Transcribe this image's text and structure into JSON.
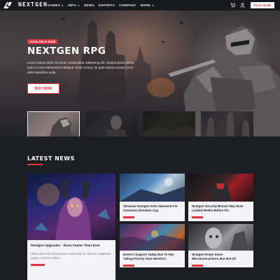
{
  "nav": {
    "brand": "NEXTGEN",
    "menu": [
      {
        "label": "GAMES",
        "has_caret": true
      },
      {
        "label": "INFO",
        "has_caret": true
      },
      {
        "label": "NEWS",
        "has_caret": false
      },
      {
        "label": "ESPORTS",
        "has_caret": false
      },
      {
        "label": "COMPANY",
        "has_caret": false
      },
      {
        "label": "MORE",
        "has_caret": true
      }
    ],
    "cart_icon": "cart-icon",
    "account_icon": "user-icon",
    "play_label": "PLAY NOW"
  },
  "hero": {
    "badge": "AVAILABLE NOW",
    "title": "NEXTGEN RPG",
    "description": "Lorem ipsum dolor sit amet, consectetur adipiscing elit. Suspendisse varius enim in eros elementum tristique. Duis cursus, mi quis viverra ornare, eros dolor interdum nulla.",
    "button": "BUY NOW",
    "thumbnails_count": 4,
    "active_thumbnail": 1
  },
  "news": {
    "title": "LATEST NEWS",
    "featured": {
      "title": "Nextgen Upgrades - Runs Faster Than Ever",
      "excerpt": "Officia eius nihil doloremque consectetur in. Sunt ut voluptatem eaque inventore dolore."
    },
    "items": [
      {
        "title": "Streamer Nextgen Gets Slammed For Generous Donation Cap"
      },
      {
        "title": "Nextgen Security Breach May Have Leaked Weeks Before Fix"
      },
      {
        "title": "Doesn't Support 1440p Due To Fps Taking Priority Over Monitors"
      },
      {
        "title": "Nextgen Drops Some Microtransactions, But Not All"
      }
    ]
  },
  "colors": {
    "accent": "#e2343f",
    "background": "#1c1e24",
    "nav": "#17191e",
    "card": "#f3f3f5"
  }
}
